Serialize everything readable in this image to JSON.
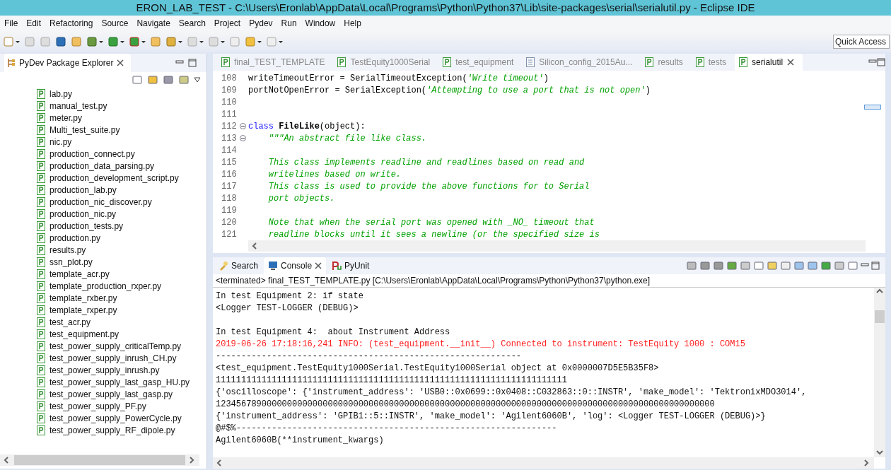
{
  "window": {
    "title": "ERON_LAB_TEST - C:\\Users\\Eronlab\\AppData\\Local\\Programs\\Python\\Python37\\Lib\\site-packages\\serial\\serialutil.py - Eclipse IDE"
  },
  "menu": [
    "File",
    "Edit",
    "Refactoring",
    "Source",
    "Navigate",
    "Search",
    "Project",
    "Pydev",
    "Run",
    "Window",
    "Help"
  ],
  "quick_access": {
    "placeholder": "Quick Access"
  },
  "explorer": {
    "title": "PyDev Package Explorer",
    "files": [
      "lab.py",
      "manual_test.py",
      "meter.py",
      "Multi_test_suite.py",
      "nic.py",
      "production_connect.py",
      "production_data_parsing.py",
      "production_development_script.py",
      "production_lab.py",
      "production_nic_discover.py",
      "production_nic.py",
      "production_tests.py",
      "production.py",
      "results.py",
      "ssn_plot.py",
      "template_acr.py",
      "template_production_rxper.py",
      "template_rxber.py",
      "template_rxper.py",
      "test_acr.py",
      "test_equipment.py",
      "test_power_supply_criticalTemp.py",
      "test_power_supply_inrush_CH.py",
      "test_power_supply_inrush.py",
      "test_power_supply_last_gasp_HU.py",
      "test_power_supply_last_gasp.py",
      "test_power_supply_PF.py",
      "test_power_supply_PowerCycle.py",
      "test_power_supply_RF_dipole.py"
    ]
  },
  "editor": {
    "tabs": [
      {
        "label": "final_TEST_TEMPLATE",
        "kind": "python",
        "selected": false
      },
      {
        "label": "TestEquity1000Serial",
        "kind": "python",
        "selected": false
      },
      {
        "label": "test_equipment",
        "kind": "python",
        "selected": false
      },
      {
        "label": "Silicon_config_2015Au...",
        "kind": "text",
        "selected": false
      },
      {
        "label": "results",
        "kind": "python",
        "selected": false
      },
      {
        "label": "tests",
        "kind": "python",
        "selected": false
      },
      {
        "label": "serialutil",
        "kind": "python",
        "selected": true
      }
    ],
    "lines": [
      {
        "number": "108",
        "fold": false,
        "segments": [
          {
            "kind": "plain",
            "text": "writeTimeoutError = SerialTimeoutException("
          },
          {
            "kind": "string",
            "text": "'Write timeout'"
          },
          {
            "kind": "plain",
            "text": ")"
          }
        ]
      },
      {
        "number": "109",
        "fold": false,
        "segments": [
          {
            "kind": "plain",
            "text": "portNotOpenError = SerialException("
          },
          {
            "kind": "string",
            "text": "'Attempting to use a port that is not open'"
          },
          {
            "kind": "plain",
            "text": ")"
          }
        ]
      },
      {
        "number": "110",
        "fold": false
      },
      {
        "number": "111",
        "fold": false
      },
      {
        "number": "112",
        "fold": true,
        "segments": [
          {
            "kind": "keyword",
            "text": "class "
          },
          {
            "kind": "name",
            "text": "FileLike"
          },
          {
            "kind": "plain",
            "text": "(object):"
          }
        ]
      },
      {
        "number": "113",
        "fold": true,
        "segments": [
          {
            "kind": "docstring",
            "text": "    \"\"\"An abstract file like class."
          }
        ]
      },
      {
        "number": "114",
        "fold": false
      },
      {
        "number": "115",
        "fold": false,
        "segments": [
          {
            "kind": "docstring",
            "text": "    This class implements readline and readlines based on read and"
          }
        ]
      },
      {
        "number": "116",
        "fold": false,
        "segments": [
          {
            "kind": "docstring",
            "text": "    writelines based on write."
          }
        ]
      },
      {
        "number": "117",
        "fold": false,
        "segments": [
          {
            "kind": "docstring",
            "text": "    This class is used to provide the above functions for to Serial"
          }
        ]
      },
      {
        "number": "118",
        "fold": false,
        "segments": [
          {
            "kind": "docstring",
            "text": "    port objects."
          }
        ]
      },
      {
        "number": "119",
        "fold": false
      },
      {
        "number": "120",
        "fold": false,
        "segments": [
          {
            "kind": "docstring",
            "text": "    Note that when the serial port was opened with _NO_ timeout that"
          }
        ]
      },
      {
        "number": "121",
        "fold": false,
        "segments": [
          {
            "kind": "docstring",
            "text": "    readline blocks until it sees a newline (or the specified size is"
          }
        ]
      }
    ]
  },
  "console": {
    "tabs": [
      {
        "label": "Search",
        "kind": "search",
        "selected": false
      },
      {
        "label": "Console",
        "kind": "console",
        "selected": true
      },
      {
        "label": "PyUnit",
        "kind": "pyunit",
        "selected": false
      }
    ],
    "header": "<terminated> final_TEST_TEMPLATE.py [C:\\Users\\Eronlab\\AppData\\Local\\Programs\\Python\\Python37\\python.exe]",
    "lines": [
      {
        "kind": "normal",
        "text": "In test Equipment 2: if state"
      },
      {
        "kind": "normal",
        "text": "<Logger TEST-LOGGER (DEBUG)>"
      },
      {
        "kind": "blank"
      },
      {
        "kind": "normal",
        "text": "In test Equipment 4:  about Instrument Address"
      },
      {
        "kind": "error",
        "text": "2019-06-26 17:18:16,241 INFO: (test_equipment.__init__) Connected to instrument: TestEquity 1000 : COM15"
      },
      {
        "kind": "normal",
        "text": "------------------------------------------------------------"
      },
      {
        "kind": "normal",
        "text": "<test_equipment.TestEquity1000Serial.TestEquity1000Serial object at 0x0000007D5E5B35F8>"
      },
      {
        "kind": "normal",
        "text": "111111111111111111111111111111111111111111111111111111111111111111111"
      },
      {
        "kind": "normal",
        "text": "{'oscilloscope': {'instrument_address': 'USB0::0x0699::0x0408::C032863::0::INSTR', 'make_model': 'TektronixMDO3014',"
      },
      {
        "kind": "normal",
        "text": "12345678900000000000000000000000000000000000000000000000000000000000000000000000000000000000000000"
      },
      {
        "kind": "normal",
        "text": "{'instrument_address': 'GPIB1::5::INSTR', 'make_model': 'Agilent6060B', 'log': <Logger TEST-LOGGER (DEBUG)>}"
      },
      {
        "kind": "normal",
        "text": "@#$%---------------------------------------------------------------"
      },
      {
        "kind": "normal",
        "text": "Agilent6060B(**instrument_kwargs)"
      }
    ]
  }
}
